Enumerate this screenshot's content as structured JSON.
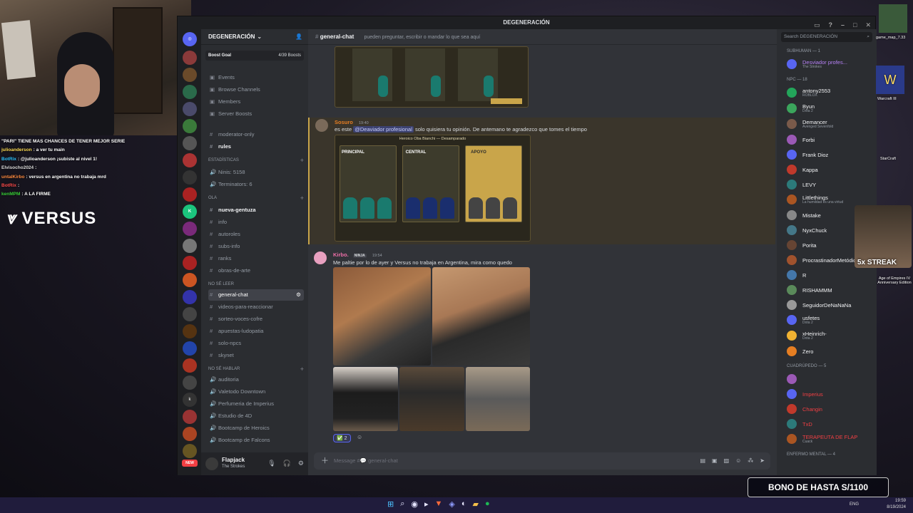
{
  "stream": {
    "chat": [
      {
        "user": "",
        "text": "\"PARI\" TIENE MAS CHANCES DE TENER MEJOR SERIE",
        "color": "#ffffff"
      },
      {
        "user": "julioanderson",
        "text": ": a ver tu main",
        "color": "#ffdd55"
      },
      {
        "user": "BotRix",
        "text": ": @julioanderson ¡subiste al nivel 1!",
        "color": "#2ec4ff"
      },
      {
        "user": "Elvisocho2024",
        "text": ":",
        "color": "#dddddd"
      },
      {
        "user": "untalKirbo",
        "text": ": versus en argentina no trabaja mrd",
        "color": "#ff8c42"
      },
      {
        "user": "BotRix",
        "text": ":",
        "color": "#ff4d4d"
      },
      {
        "user": "kenMPM",
        "text": ": A LA FIRME",
        "color": "#3ad13a"
      }
    ],
    "versus_logo": "VERSUS",
    "bono_banner": "BONO DE HASTA S/1100",
    "streak_label": "5x STREAK",
    "desktop_labels": [
      "game_map_7.33",
      "Warcraft III",
      "StarCraft",
      "Age of Empires IV Anniversary Edition"
    ]
  },
  "discord": {
    "window_title": "DEGENERACIÓN",
    "server_name": "DEGENERACIÓN",
    "boost_goal": {
      "label": "Boost Goal",
      "value": "4/39 Boosts"
    },
    "top_links": [
      "Events",
      "Browse Channels",
      "Members",
      "Server Boosts"
    ],
    "channels_top": [
      "moderator-only",
      "rules"
    ],
    "stats_category": "Estadísticas",
    "stats": [
      "Ninis: 5158",
      "Terminators: 6"
    ],
    "cat_ola": "ola",
    "channels_ola": [
      "nueva-gentuza",
      "info",
      "autoroles",
      "subs-info",
      "ranks",
      "obras-de-arte"
    ],
    "cat_nose_leer": "NO SÉ LEER",
    "channels_leer": [
      "general-chat",
      "videos-para-reaccionar",
      "sorteo-voces-cofre",
      "apuestas-ludopatia",
      "solo-npcs",
      "skynet"
    ],
    "cat_nose_hablar": "NO SÉ HABLAR",
    "voice_channels": [
      "auditoria",
      "Valetodo Downtown",
      "Perfumeria de Imperius",
      "Estudio de 4D",
      "Bootcamp de Heroics",
      "Bootcamp de Falcons"
    ],
    "user": {
      "name": "Flapjack",
      "status": "The Strokes"
    },
    "channel": {
      "name": "general-chat",
      "topic": "pueden preguntar, escribir o mandar lo que sea aquí"
    },
    "messages": [
      {
        "author": "Sosuro",
        "time": "19:40",
        "mention": "@Deaviador profesional",
        "text_before": "es este",
        "text_after": "solo quisiera tu opinión. De antemano te agradezco que tomes el tiempo",
        "cards": [
          "PRINCIPAL",
          "CENTRAL",
          "APOYO"
        ],
        "card_caption": "Heroico Oba Bianchi — Desamparado"
      },
      {
        "author": "Kirbo.",
        "tag": "NINJA",
        "time": "19:54",
        "text": "Me paltie por lo de ayer y Versus no trabaja en Argentina, mira como quedo",
        "reaction": {
          "emoji": "✅",
          "count": "2"
        }
      }
    ],
    "composer_placeholder": "Message #💬 general-chat",
    "search_placeholder": "Search DEGENERACIÓN",
    "members": {
      "groups": [
        {
          "title": "SUBHUMAN — 1",
          "items": [
            {
              "name": "Desviador profes...",
              "status": "The Strokes",
              "color": "#b681f5"
            }
          ]
        },
        {
          "title": "NPC — 18",
          "items": [
            {
              "name": "antony2553",
              "status": "ROBLOX",
              "color": "#f2f3f5"
            },
            {
              "name": "Byun",
              "status": "Dota 2",
              "color": "#f2f3f5"
            },
            {
              "name": "Demancer",
              "status": "Avenged Sevenfold",
              "color": "#f2f3f5"
            },
            {
              "name": "Forbi",
              "status": "",
              "color": "#f2f3f5"
            },
            {
              "name": "Frank Dioz",
              "status": "",
              "color": "#f2f3f5"
            },
            {
              "name": "Kappa",
              "status": "",
              "color": "#f2f3f5"
            },
            {
              "name": "LEVY",
              "status": "",
              "color": "#f2f3f5"
            },
            {
              "name": "Littlethings",
              "status": "La humildad es una virtud",
              "color": "#f2f3f5"
            },
            {
              "name": "Mistake",
              "status": "",
              "color": "#f2f3f5"
            },
            {
              "name": "NyxChuck",
              "status": "",
              "color": "#f2f3f5"
            },
            {
              "name": "Porita",
              "status": "",
              "color": "#f2f3f5"
            },
            {
              "name": "ProcrastinadorMetódico",
              "status": "",
              "color": "#f2f3f5"
            },
            {
              "name": "R",
              "status": "",
              "color": "#f2f3f5"
            },
            {
              "name": "RISHAMMM",
              "status": "",
              "color": "#f2f3f5"
            },
            {
              "name": "SeguidorDeNaNaNa",
              "status": "",
              "color": "#f2f3f5"
            },
            {
              "name": "usfetes",
              "status": "Dota 2",
              "color": "#f2f3f5"
            },
            {
              "name": "xHeinrich-",
              "status": "Dota 2",
              "color": "#f2f3f5"
            },
            {
              "name": "Zero",
              "status": "",
              "color": "#f2f3f5"
            }
          ]
        },
        {
          "title": "Cuadrúpedo — 5",
          "items": [
            {
              "name": "",
              "status": "",
              "color": "#f23f43"
            },
            {
              "name": "Imperius",
              "status": "",
              "color": "#f23f43"
            },
            {
              "name": "Changin",
              "status": "",
              "color": "#f23f43"
            },
            {
              "name": "TxD",
              "status": "",
              "color": "#f23f43"
            },
            {
              "name": "TERAPEUTA DE FLAP",
              "status": "Cuack",
              "color": "#f23f43"
            }
          ]
        },
        {
          "title": "Enfermo mental — 4",
          "items": []
        }
      ]
    }
  },
  "taskbar": {
    "lang": "ENG",
    "time": "19:59",
    "date": "8/19/2024"
  }
}
